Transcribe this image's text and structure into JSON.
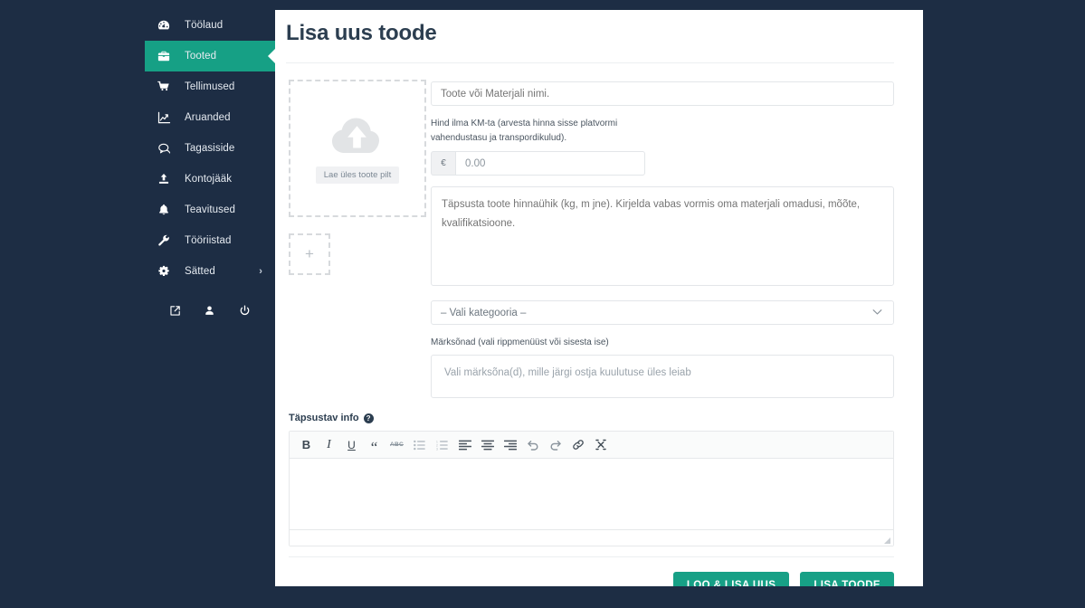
{
  "theme": {
    "page_background": "#1d2d44",
    "sidebar_background": "#1d2d44",
    "accent_teal": "#16a085",
    "button_teal": "#17a086",
    "title_color": "#2c3e50"
  },
  "sidebar": {
    "items": [
      {
        "label": "Töölaud",
        "icon": "dashboard-icon",
        "active": false,
        "chevron": ""
      },
      {
        "label": "Tooted",
        "icon": "briefcase-icon",
        "active": true,
        "chevron": ""
      },
      {
        "label": "Tellimused",
        "icon": "shopping-cart-icon",
        "active": false,
        "chevron": ""
      },
      {
        "label": "Aruanded",
        "icon": "chart-line-icon",
        "active": false,
        "chevron": ""
      },
      {
        "label": "Tagasiside",
        "icon": "comments-icon",
        "active": false,
        "chevron": ""
      },
      {
        "label": "Kontojääk",
        "icon": "upload-icon",
        "active": false,
        "chevron": ""
      },
      {
        "label": "Teavitused",
        "icon": "bell-icon",
        "active": false,
        "chevron": ""
      },
      {
        "label": "Tööriistad",
        "icon": "wrench-icon",
        "active": false,
        "chevron": ""
      },
      {
        "label": "Sätted",
        "icon": "gear-icon",
        "active": false,
        "chevron": "›"
      }
    ],
    "footer_icons": [
      "external-link-icon",
      "user-icon",
      "power-icon"
    ]
  },
  "header": {
    "title": "Lisa uus toode"
  },
  "upload": {
    "caption": "Lae üles toote pilt",
    "add_more_label": "+"
  },
  "form": {
    "name_placeholder": "Toote või Materjali nimi.",
    "price_label": "Hind ilma KM-ta (arvesta hinna sisse platvormi vahendustasu ja transpordikulud).",
    "price_currency": "€",
    "price_value": "0.00",
    "description_placeholder": "Täpsusta toote hinnaühik (kg, m jne). Kirjelda vabas vormis oma materjali omadusi, mõõte, kvalifikatsioone.",
    "category_selected": "– Vali kategooria –",
    "tags_label": "Märksõnad (vali rippmenüüst või sisesta ise)",
    "tags_placeholder": "Vali märksõna(d), mille järgi ostja kuulutuse üles leiab"
  },
  "editor": {
    "label": "Täpsustav info",
    "help_glyph": "?",
    "toolbar": [
      {
        "name": "bold-icon",
        "glyph": "B"
      },
      {
        "name": "italic-icon",
        "glyph": "I"
      },
      {
        "name": "underline-icon",
        "glyph": "U"
      },
      {
        "name": "blockquote-icon",
        "glyph": "“"
      },
      {
        "name": "strikethrough-icon",
        "glyph": "ABC"
      },
      {
        "name": "unordered-list-icon",
        "glyph": ""
      },
      {
        "name": "ordered-list-icon",
        "glyph": ""
      },
      {
        "name": "align-left-icon",
        "glyph": ""
      },
      {
        "name": "align-center-icon",
        "glyph": ""
      },
      {
        "name": "align-right-icon",
        "glyph": ""
      },
      {
        "name": "undo-icon",
        "glyph": ""
      },
      {
        "name": "redo-icon",
        "glyph": ""
      },
      {
        "name": "link-icon",
        "glyph": ""
      },
      {
        "name": "clear-format-icon",
        "glyph": ""
      }
    ],
    "content": ""
  },
  "actions": {
    "secondary_label": "LOO & LISA UUS",
    "primary_label": "LISA TOODE"
  }
}
